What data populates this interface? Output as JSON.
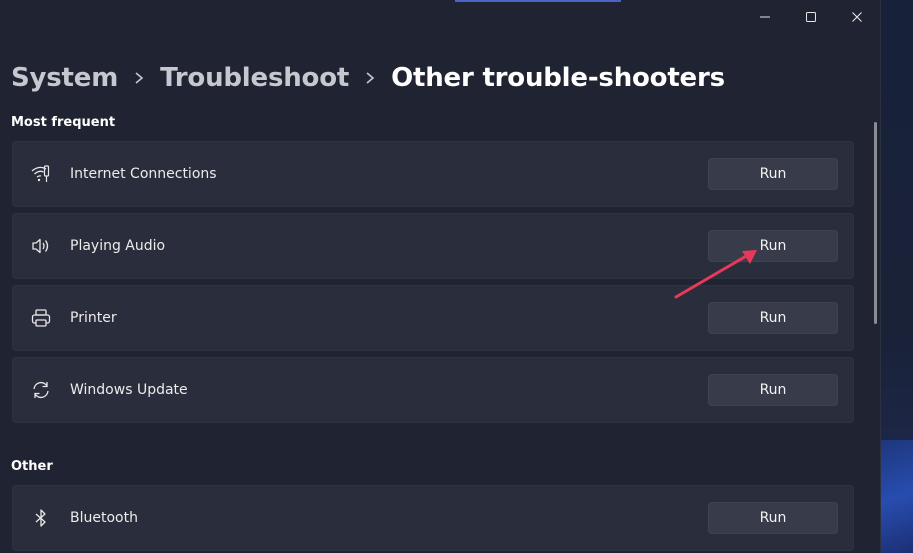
{
  "window": {
    "minimize_icon": "minimize-icon",
    "maximize_icon": "maximize-icon",
    "close_icon": "close-icon"
  },
  "breadcrumb": {
    "items": [
      "System",
      "Troubleshoot",
      "Other trouble-shooters"
    ],
    "separator_icon": "chevron-right-icon"
  },
  "sections": [
    {
      "title": "Most frequent",
      "items": [
        {
          "label": "Internet Connections",
          "icon": "wifi-icon",
          "button": "Run"
        },
        {
          "label": "Playing Audio",
          "icon": "speaker-icon",
          "button": "Run"
        },
        {
          "label": "Printer",
          "icon": "printer-icon",
          "button": "Run"
        },
        {
          "label": "Windows Update",
          "icon": "refresh-icon",
          "button": "Run"
        }
      ]
    },
    {
      "title": "Other",
      "items": [
        {
          "label": "Bluetooth",
          "icon": "bluetooth-icon",
          "button": "Run"
        }
      ]
    }
  ],
  "colors": {
    "window_bg": "#202331",
    "card_bg": "#2a2d3b",
    "button_bg": "#383b4a",
    "annotation_arrow": "#e8395a"
  }
}
